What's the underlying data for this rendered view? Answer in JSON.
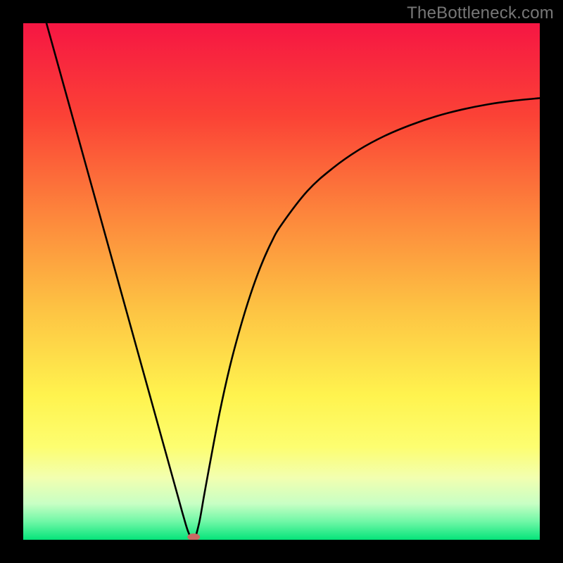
{
  "watermark": "TheBottleneck.com",
  "chart_data": {
    "type": "line",
    "title": "",
    "xlabel": "",
    "ylabel": "",
    "xlim": [
      0,
      100
    ],
    "ylim": [
      0,
      100
    ],
    "background_gradient": {
      "stops": [
        {
          "pos": 0.0,
          "color": "#f61643"
        },
        {
          "pos": 0.18,
          "color": "#fb4236"
        },
        {
          "pos": 0.38,
          "color": "#fd893c"
        },
        {
          "pos": 0.55,
          "color": "#fdc243"
        },
        {
          "pos": 0.72,
          "color": "#fff34e"
        },
        {
          "pos": 0.82,
          "color": "#fdfe70"
        },
        {
          "pos": 0.88,
          "color": "#f2ffb0"
        },
        {
          "pos": 0.93,
          "color": "#c8ffc4"
        },
        {
          "pos": 0.965,
          "color": "#6ff7a6"
        },
        {
          "pos": 1.0,
          "color": "#05e47a"
        }
      ]
    },
    "series": [
      {
        "name": "bottleneck-curve",
        "color": "#000000",
        "x": [
          4.5,
          6,
          8,
          10,
          12,
          14,
          16,
          18,
          20,
          22,
          24,
          26,
          28,
          30,
          31,
          32,
          33,
          34,
          35,
          36,
          38,
          40,
          42,
          44,
          46,
          48,
          50,
          55,
          60,
          65,
          70,
          75,
          80,
          85,
          90,
          95,
          100
        ],
        "y": [
          100,
          94.6,
          87.4,
          80.2,
          73.0,
          65.8,
          58.6,
          51.4,
          44.2,
          37.0,
          29.8,
          22.6,
          15.4,
          8.2,
          4.6,
          1.4,
          0.0,
          3.0,
          8.5,
          14.0,
          24.5,
          33.5,
          41.0,
          47.5,
          53.0,
          57.5,
          61.0,
          67.5,
          72.0,
          75.5,
          78.2,
          80.3,
          82.0,
          83.3,
          84.3,
          85.0,
          85.5
        ]
      }
    ],
    "marker": {
      "name": "min-marker",
      "x": 33,
      "y": 0,
      "color": "#c96a63"
    }
  }
}
